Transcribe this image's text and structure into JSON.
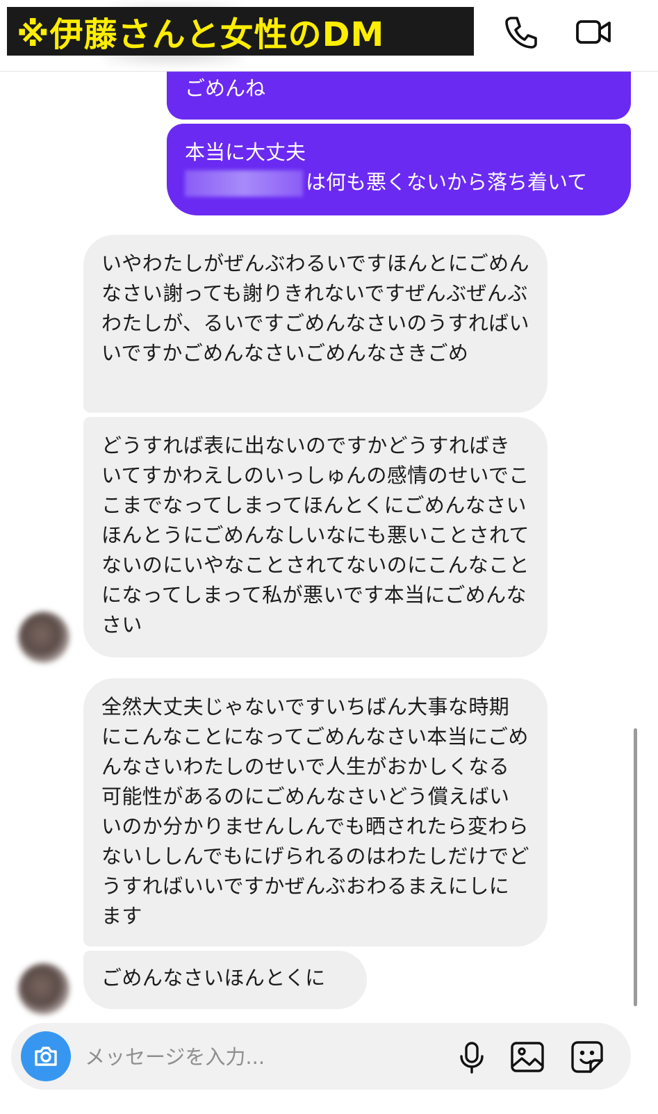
{
  "header": {
    "caption": "※伊藤さんと女性のDM",
    "call_icon": "phone-icon",
    "video_icon": "video-camera-icon"
  },
  "messages": {
    "outgoing": [
      {
        "text": "ごめんね"
      },
      {
        "line1": "本当に大丈夫",
        "line2": "は何も悪くないから落ち着いて"
      }
    ],
    "incoming": [
      {
        "text": "いやわたしがぜんぶわるいですほんとにごめんなさい謝っても謝りきれないですぜんぶぜんぶわたしが、るいですごめんなさいのうすればいいですかごめんなさいごめんなさきごめ"
      },
      {
        "text": "どうすれば表に出ないのですかどうすればきいてすかわえしのいっしゅんの感情のせいでここまでなってしまってほんとくにごめんなさいほんとうにごめんなしいなにも悪いことされてないのにいやなことされてないのにこんなことになってしまって私が悪いです本当にごめんなさい"
      },
      {
        "text": "全然大丈夫じゃないですいちばん大事な時期にこんなことになってごめんなさい本当にごめんなさいわたしのせいで人生がおかしくなる可能性があるのにごめんなさいどう償えばいいのか分かりませんしんでも晒されたら変わらないししんでもにげられるのはわたしだけでどうすればいいですかぜんぶおわるまえにしにます"
      },
      {
        "text": "ごめんなさいほんとくに"
      }
    ]
  },
  "composer": {
    "placeholder": "メッセージを入力...",
    "camera_icon": "camera-icon",
    "mic_icon": "microphone-icon",
    "gallery_icon": "image-icon",
    "sticker_icon": "sticker-icon"
  },
  "colors": {
    "outgoing_bubble": "#6a2af2",
    "incoming_bubble": "#efefef",
    "camera_button": "#3797f0",
    "caption_text": "#ffee00",
    "caption_bg": "#1a1a1a"
  }
}
